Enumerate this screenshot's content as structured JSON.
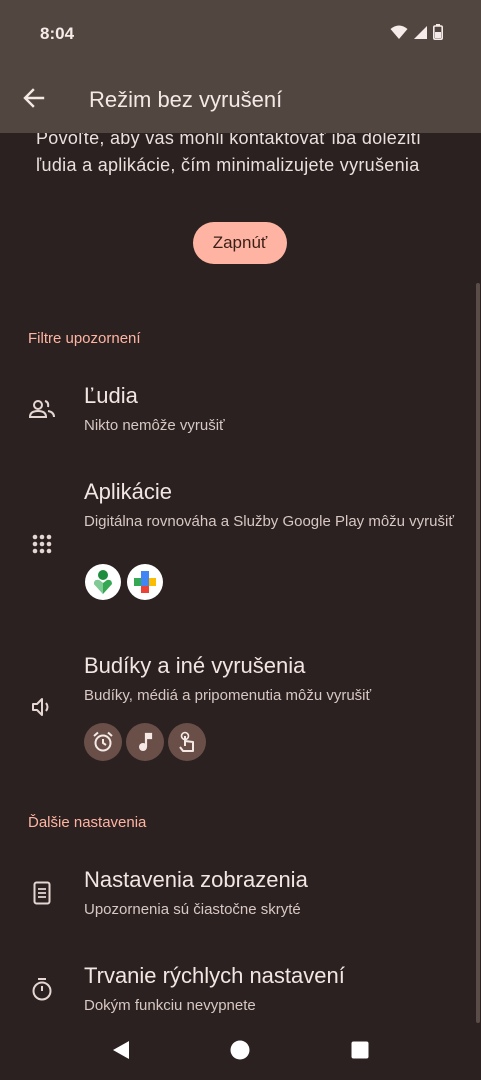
{
  "status_bar": {
    "time": "8:04",
    "icons": [
      "wifi-icon",
      "signal-icon",
      "battery-icon"
    ]
  },
  "app_bar": {
    "title": "Režim bez vyrušení",
    "back_icon": "arrow-back-icon"
  },
  "intro": {
    "text": "Povoľte, aby vás mohli kontaktovať iba dôležití ľudia a aplikácie, čím minimalizujete vyrušenia",
    "button_label": "Zapnúť"
  },
  "sections": {
    "filters_header": "Filtre upozornení",
    "more_header": "Ďalšie nastavenia"
  },
  "items": {
    "people": {
      "title": "Ľudia",
      "subtitle": "Nikto nemôže vyrušiť",
      "icon": "people-icon"
    },
    "apps": {
      "title": "Aplikácie",
      "subtitle": "Digitálna rovnováha a Služby Google Play môžu vyrušiť",
      "icon": "apps-grid-icon",
      "badges": [
        "digital-wellbeing-icon",
        "google-play-services-icon"
      ]
    },
    "alarms": {
      "title": "Budíky a iné vyrušenia",
      "subtitle": "Budíky, médiá a pripomenutia môžu vyrušiť",
      "icon": "volume-icon",
      "badges": [
        "alarm-clock-icon",
        "music-note-icon",
        "touch-icon"
      ]
    },
    "display": {
      "title": "Nastavenia zobrazenia",
      "subtitle": "Upozornenia sú čiastočne skryté",
      "icon": "phone-display-icon"
    },
    "duration": {
      "title": "Trvanie rýchlych nastavení",
      "subtitle": "Dokým funkciu nevypnete",
      "icon": "timer-icon"
    }
  },
  "nav": {
    "icons": [
      "nav-back-icon",
      "nav-home-icon",
      "nav-recents-icon"
    ]
  },
  "colors": {
    "background": "#2a2120",
    "app_bar": "#524641",
    "accent": "#ffb4a3",
    "badge": "#6a4f49"
  }
}
